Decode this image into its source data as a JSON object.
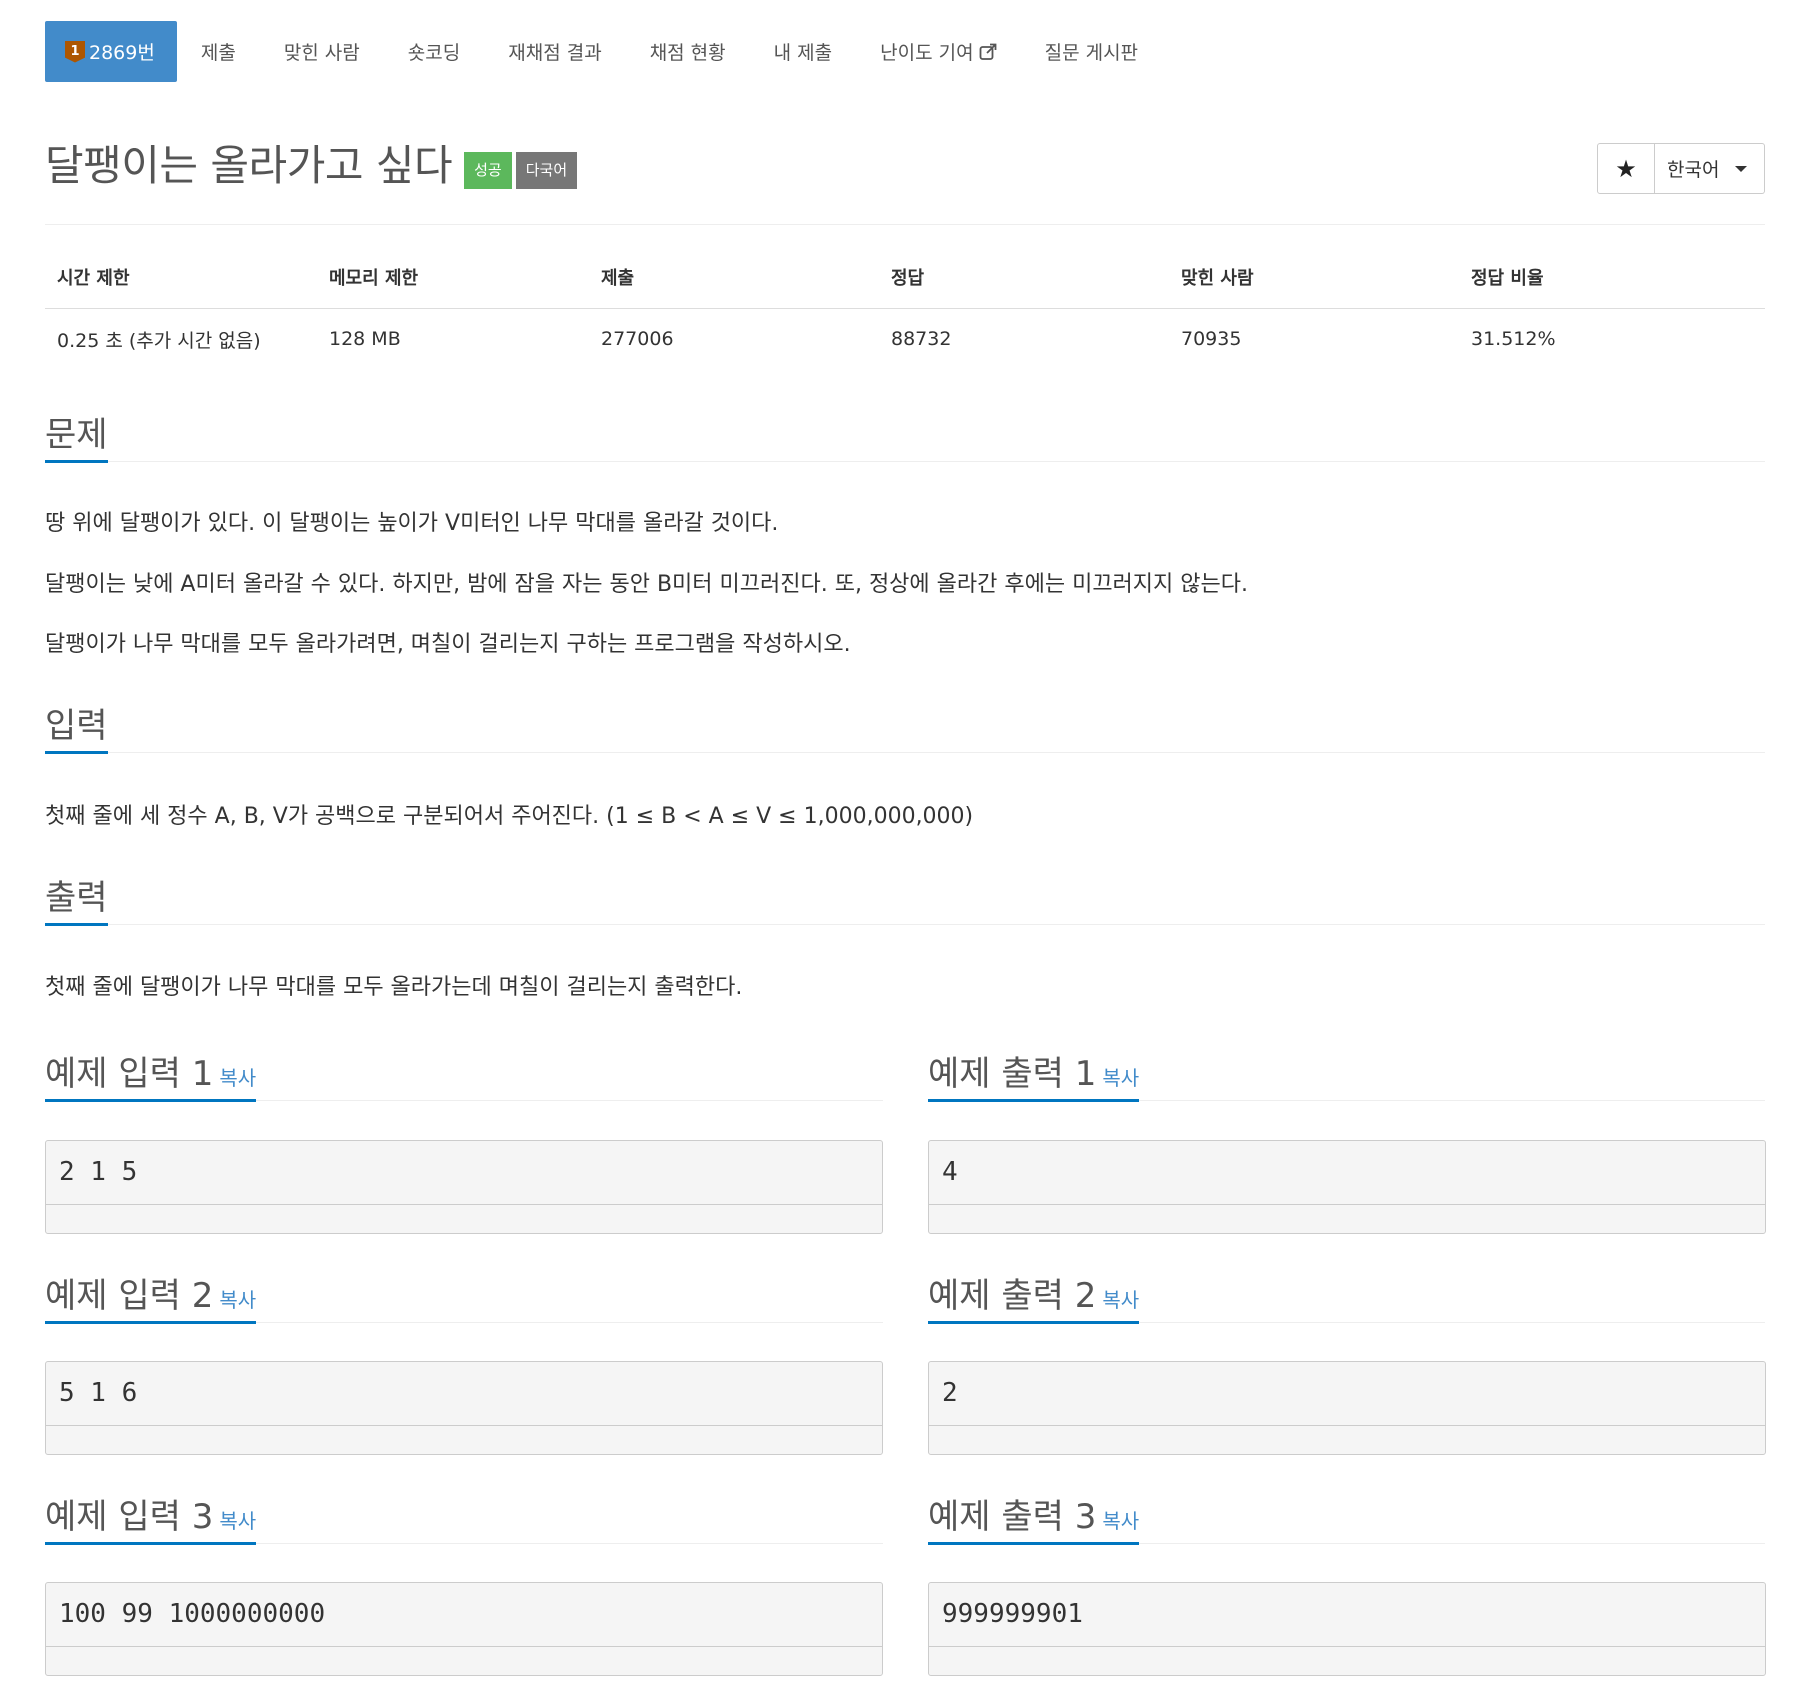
{
  "nav": {
    "tabs": [
      {
        "label": "2869번",
        "active": true,
        "tier": "1"
      },
      {
        "label": "제출"
      },
      {
        "label": "맞힌 사람"
      },
      {
        "label": "숏코딩"
      },
      {
        "label": "재채점 결과"
      },
      {
        "label": "채점 현황"
      },
      {
        "label": "내 제출"
      },
      {
        "label": "난이도 기여"
      },
      {
        "label": "질문 게시판"
      }
    ]
  },
  "problem": {
    "title": "달팽이는 올라가고 싶다",
    "labels": {
      "success": "성공",
      "multilang": "다국어"
    },
    "star": "★",
    "language": "한국어"
  },
  "info": {
    "headers": [
      "시간 제한",
      "메모리 제한",
      "제출",
      "정답",
      "맞힌 사람",
      "정답 비율"
    ],
    "values": [
      "0.25 초 (추가 시간 없음)",
      "128 MB",
      "277006",
      "88732",
      "70935",
      "31.512%"
    ]
  },
  "sections": {
    "description_title": "문제",
    "description": [
      "땅 위에 달팽이가 있다. 이 달팽이는 높이가 V미터인 나무 막대를 올라갈 것이다.",
      "달팽이는 낮에 A미터 올라갈 수 있다. 하지만, 밤에 잠을 자는 동안 B미터 미끄러진다. 또, 정상에 올라간 후에는 미끄러지지 않는다.",
      "달팽이가 나무 막대를 모두 올라가려면, 며칠이 걸리는지 구하는 프로그램을 작성하시오."
    ],
    "input_title": "입력",
    "input": "첫째 줄에 세 정수 A, B, V가 공백으로 구분되어서 주어진다. (1 ≤ B < A ≤ V ≤ 1,000,000,000)",
    "output_title": "출력",
    "output": "첫째 줄에 달팽이가 나무 막대를 모두 올라가는데 며칠이 걸리는지 출력한다."
  },
  "copy_label": "복사",
  "samples": [
    {
      "input_title": "예제 입력 1",
      "output_title": "예제 출력 1",
      "input": "2 1 5",
      "output": "4"
    },
    {
      "input_title": "예제 입력 2",
      "output_title": "예제 출력 2",
      "input": "5 1 6",
      "output": "2"
    },
    {
      "input_title": "예제 입력 3",
      "output_title": "예제 출력 3",
      "input": "100 99 1000000000",
      "output": "999999901"
    }
  ]
}
